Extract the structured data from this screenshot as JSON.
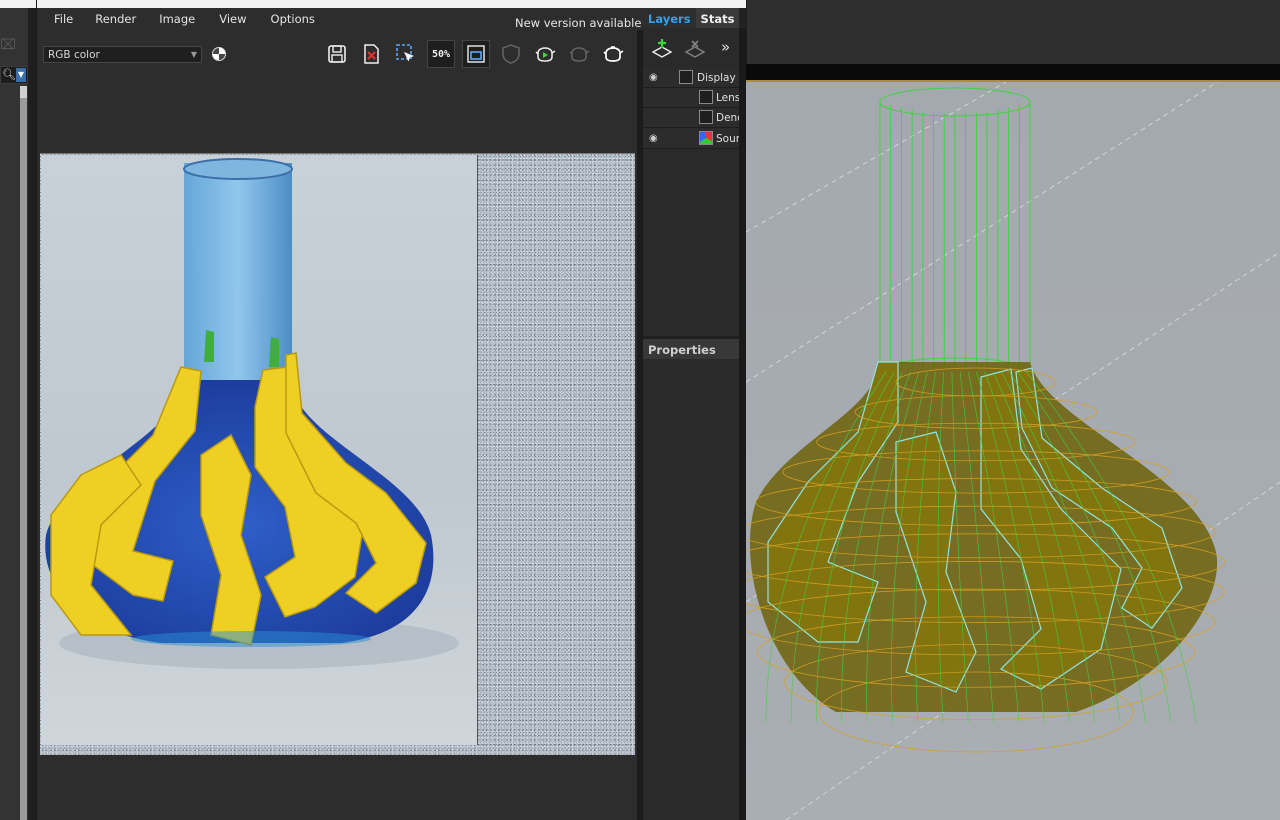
{
  "frame_buffer": {
    "menu": {
      "file": "File",
      "render": "Render",
      "image": "Image",
      "view": "View",
      "options": "Options"
    },
    "new_version": "New version available!",
    "channel": {
      "selected": "RGB color"
    },
    "zoom_label": "50%"
  },
  "layers_panel": {
    "tabs": {
      "layers": "Layers",
      "stats": "Stats"
    },
    "layers": [
      {
        "name": "Display Correction"
      },
      {
        "name": "Lens Effects"
      },
      {
        "name": "Denoiser"
      },
      {
        "name": "Source: RGB"
      }
    ],
    "properties_label": "Properties"
  },
  "colors": {
    "accent_tab": "#3aa0e6",
    "mesh_green": "#3fd43f",
    "mesh_yellow": "#f2d32c",
    "mesh_olive": "#7a6e0c"
  }
}
